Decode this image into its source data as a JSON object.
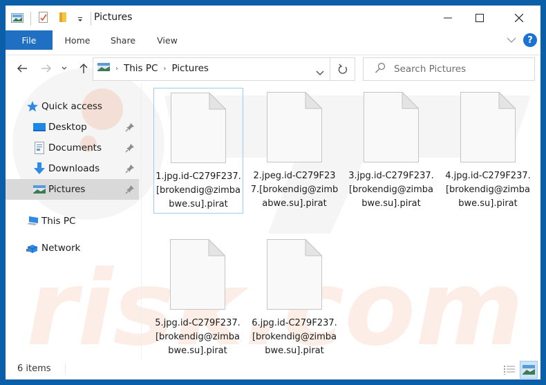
{
  "window": {
    "title": "Pictures",
    "controls": {
      "minimize": "minimize-icon",
      "maximize": "maximize-icon",
      "close": "close-icon"
    }
  },
  "quick_access_toolbar": {
    "icons": [
      "pictures-app-icon",
      "properties-icon",
      "new-folder-icon",
      "customize-dropdown-icon"
    ]
  },
  "ribbon": {
    "tabs": [
      {
        "label": "File",
        "active": true
      },
      {
        "label": "Home"
      },
      {
        "label": "Share"
      },
      {
        "label": "View"
      }
    ],
    "expand_icon": "chevron-down-icon",
    "help_icon": "help-icon",
    "help_label": "?"
  },
  "navigation": {
    "back_icon": "back-arrow-icon",
    "forward_icon": "forward-arrow-icon",
    "recent_icon": "chevron-down-icon",
    "up_icon": "up-arrow-icon",
    "breadcrumb": [
      "This PC",
      "Pictures"
    ],
    "breadcrumb_separator": "›",
    "refresh_icon": "refresh-icon",
    "search_placeholder": "Search Pictures"
  },
  "sidebar": {
    "items": [
      {
        "label": "Quick access",
        "icon": "star-icon",
        "level": 0
      },
      {
        "label": "Desktop",
        "icon": "desktop-icon",
        "level": 1,
        "pinned": true
      },
      {
        "label": "Documents",
        "icon": "documents-icon",
        "level": 1,
        "pinned": true
      },
      {
        "label": "Downloads",
        "icon": "downloads-icon",
        "level": 1,
        "pinned": true
      },
      {
        "label": "Pictures",
        "icon": "pictures-icon",
        "level": 1,
        "pinned": true,
        "selected": true
      },
      {
        "label": "This PC",
        "icon": "computer-icon",
        "level": 0
      },
      {
        "label": "Network",
        "icon": "network-icon",
        "level": 0
      }
    ]
  },
  "files": [
    {
      "name": "1.jpg.id-C279F237.[brokendig@zimbabwe.su].pirat",
      "selected": true
    },
    {
      "name": "2.jpeg.id-C279F237.[brokendig@zimbabwe.su].pirat"
    },
    {
      "name": "3.jpg.id-C279F237.[brokendig@zimbabwe.su].pirat"
    },
    {
      "name": "4.jpg.id-C279F237.[brokendig@zimbabwe.su].pirat"
    },
    {
      "name": "5.jpg.id-C279F237.[brokendig@zimbabwe.su].pirat"
    },
    {
      "name": "6.jpg.id-C279F237.[brokendig@zimbabwe.su].pirat"
    }
  ],
  "status": {
    "item_count": "6 items",
    "views": [
      {
        "name": "details-view-icon",
        "active": false
      },
      {
        "name": "large-icons-view-icon",
        "active": true
      }
    ]
  },
  "watermark": {
    "text": "risk.com"
  },
  "colors": {
    "frame": "#0b5ea8",
    "file_tab": "#1f6fc2",
    "selected_sidebar": "#d9d9d9",
    "selection_border": "#9dcbf0",
    "help": "#1a73d1"
  }
}
